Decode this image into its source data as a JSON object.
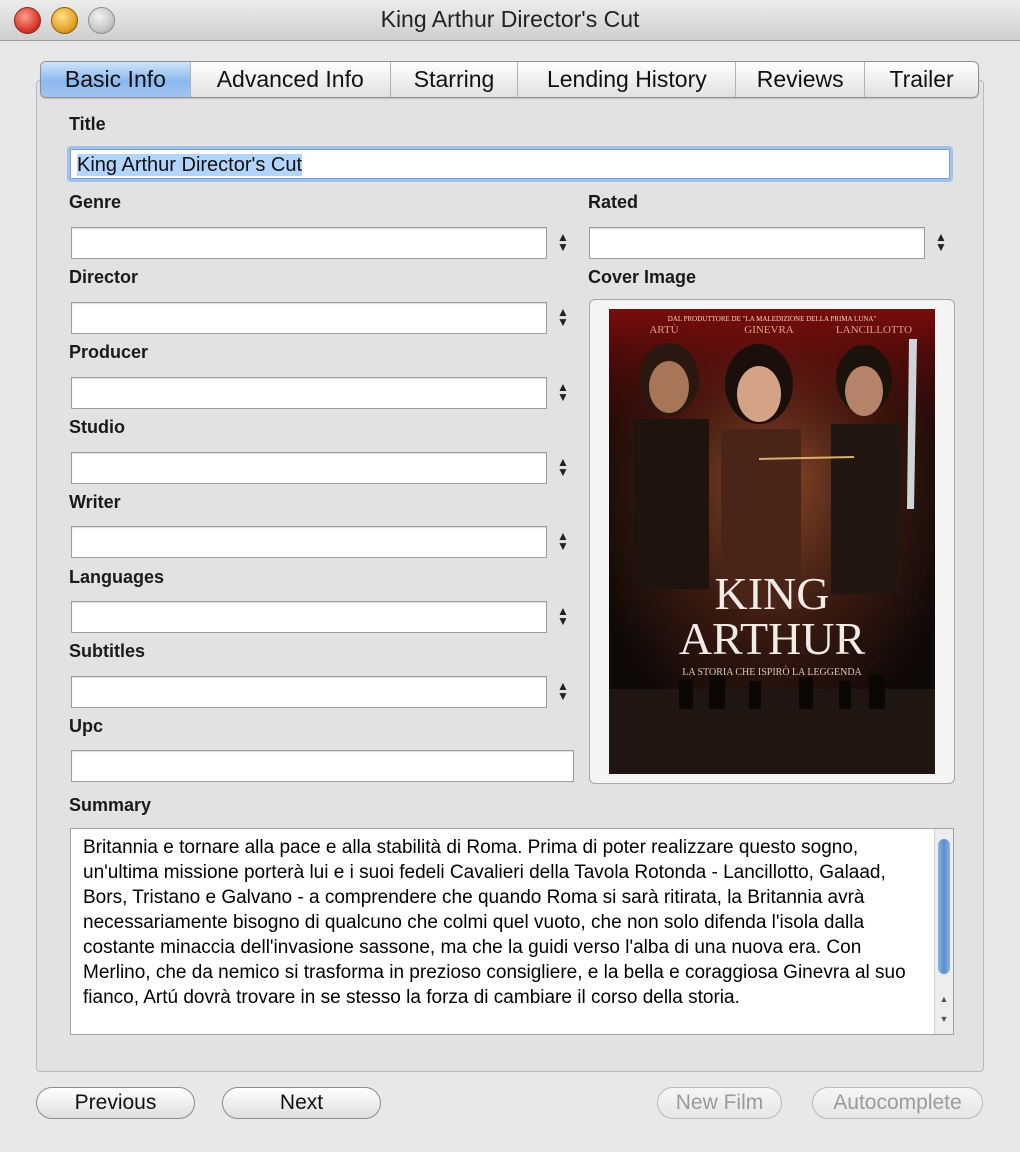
{
  "window": {
    "title": "King Arthur Director's Cut"
  },
  "tabs": [
    {
      "label": "Basic Info"
    },
    {
      "label": "Advanced Info"
    },
    {
      "label": "Starring"
    },
    {
      "label": "Lending History"
    },
    {
      "label": "Reviews"
    },
    {
      "label": "Trailer"
    }
  ],
  "labels": {
    "title": "Title",
    "genre": "Genre",
    "rated": "Rated",
    "director": "Director",
    "cover_image": "Cover Image",
    "producer": "Producer",
    "studio": "Studio",
    "writer": "Writer",
    "languages": "Languages",
    "subtitles": "Subtitles",
    "upc": "Upc",
    "summary": "Summary"
  },
  "fields": {
    "title_value": "King Arthur Director's Cut"
  },
  "poster": {
    "tagline_top": "DAL PRODUTTORE DE \"LA MALEDIZIONE DELLA PRIMA LUNA\"",
    "cast": [
      "ARTÙ",
      "GINEVRA",
      "LANCILLOTTO"
    ],
    "title_line1": "KING",
    "title_line2": "ARTHUR",
    "subtitle": "LA STORIA CHE ISPIRÒ LA LEGGENDA"
  },
  "summary": {
    "text": "Britannia e tornare alla pace e alla stabilità di Roma. Prima di poter realizzare questo sogno, un'ultima missione porterà lui e i suoi fedeli Cavalieri della Tavola Rotonda - Lancillotto, Galaad, Bors, Tristano e Galvano - a comprendere che quando Roma si sarà ritirata, la Britannia avrà necessariamente bisogno di qualcuno che colmi quel vuoto, che non solo difenda l'isola dalla costante minaccia dell'invasione sassone, ma che la guidi verso l'alba di una nuova era. Con Merlino, che da nemico si trasforma in prezioso consigliere, e la bella e coraggiosa Ginevra al suo fianco, Artú dovrà trovare in se stesso la forza di cambiare il corso della storia."
  },
  "buttons": {
    "previous": "Previous",
    "next": "Next",
    "new_film": "New Film",
    "autocomplete": "Autocomplete"
  },
  "colors": {
    "active_tab": "#8ab8ee",
    "focus_ring": "#9fc2ee"
  }
}
